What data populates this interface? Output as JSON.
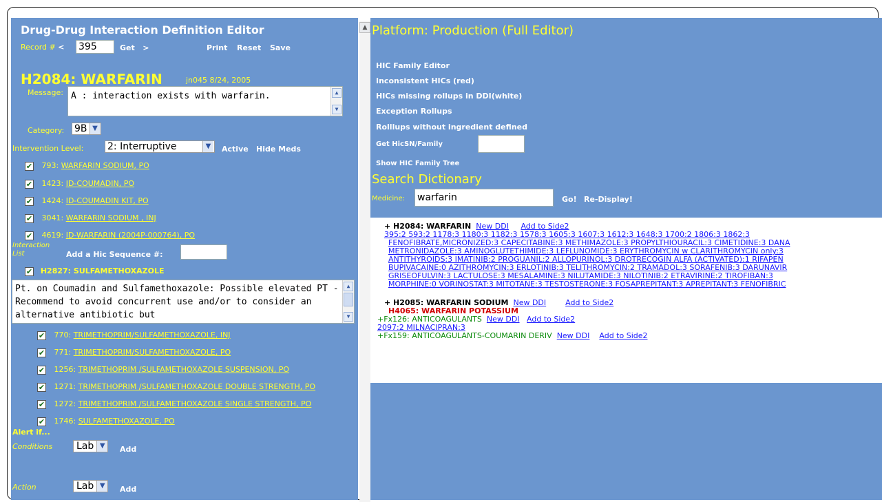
{
  "editor": {
    "title": "Drug-Drug Interaction Definition Editor",
    "record_label": "Record #",
    "record_lt": "<",
    "record_value": "395",
    "get_label": "Get",
    "get_gt": ">",
    "print": "Print",
    "reset": "Reset",
    "save": "Save",
    "hic_heading": "H2084: WARFARIN",
    "hic_meta": "jn045 8/24, 2005",
    "message_label": "Message:",
    "message_value": "A : interaction exists with warfarin.",
    "category_label": "Category:",
    "category_value": "9B",
    "intervention_label": "Intervention Level:",
    "intervention_value": "2: Interruptive",
    "active": "Active",
    "hide_meds": "Hide Meds",
    "meds1": [
      {
        "id": "793:",
        "name": "WARFARIN SODIUM, PO"
      },
      {
        "id": "1423:",
        "name": "ID-COUMADIN, PO"
      },
      {
        "id": "1424:",
        "name": "ID-COUMADIN KIT, PO"
      },
      {
        "id": "3041:",
        "name": "WARFARIN SODIUM , INJ"
      },
      {
        "id": "4619:",
        "name": "ID-WARFARIN (2004P-000764), PO"
      }
    ],
    "interaction_list_label": "Interaction List",
    "add_hic_label": "Add a Hic Sequence #:",
    "hic2_heading": "H2827: SULFAMETHOXAZOLE",
    "hic2_message": "Pt. on Coumadin and Sulfamethoxazole: Possible elevated PT - Recommend to avoid concurrent use and/or to consider an alternative antibiotic but",
    "meds2": [
      {
        "id": "770:",
        "name": "TRIMETHOPRIM/SULFAMETHOXAZOLE, INJ"
      },
      {
        "id": "771:",
        "name": "TRIMETHOPRIM/SULFAMETHOXAZOLE, PO"
      },
      {
        "id": "1256:",
        "name": "TRIMETHOPRIM /SULFAMETHOXAZOLE SUSPENSION, PO"
      },
      {
        "id": "1271:",
        "name": "TRIMETHOPRIM /SULFAMETHOXAZOLE DOUBLE STRENGTH, PO"
      },
      {
        "id": "1272:",
        "name": "TRIMETHOPRIM /SULFAMETHOXAZOLE SINGLE STRENGTH, PO"
      },
      {
        "id": "1746:",
        "name": "SULFAMETHOXAZOLE, PO"
      }
    ],
    "alert_if": "Alert if...",
    "conditions_label": "Conditions",
    "conditions_value": "Lab",
    "add": "Add",
    "action_label": "Action",
    "action_value": "Lab"
  },
  "platform": {
    "title": "Platform: Production (Full Editor)",
    "links": [
      "HIC Family Editor",
      "Inconsistent HICs (red)",
      "HICs missing rollups in DDI(white)",
      "Exception Rollups",
      "Rolllups without ingredient defined"
    ],
    "get_hicsn_label": "Get HicSN/Family",
    "show_tree": "Show HIC Family Tree",
    "search_title": "Search Dictionary",
    "medicine_label": "Medicine:",
    "medicine_value": "warfarin",
    "go": "Go!",
    "redisplay": "Re-Display!"
  },
  "results": {
    "r1_prefix": "+ H2084: WARFARIN",
    "new_ddi": "New DDI",
    "add_side2": "Add to Side2",
    "r1_lines": [
      "395:2  593:2  1178:3  1180:3  1182:3  1578:3  1605:3  1607:3  1612:3  1648:3  1700:2  1806:3  1862:3",
      "FENOFIBRATE,MICRONIZED:3  CAPECITABINE:3  METHIMAZOLE:3  PROPYLTHIOURACIL:3  CIMETIDINE:3  DANA",
      "METRONIDAZOLE:3  AMINOGLUTETHIMIDE:3  LEFLUNOMIDE:3  ERYTHROMYCIN w CLARITHROMYCIN only:3",
      "ANTITHYROIDS:3  IMATINIB:2  PROGUANIL:2  ALLOPURINOL:3  DROTRECOGIN ALFA (ACTIVATED):1  RIFAPEN",
      "BUPIVACAINE:0  AZITHROMYCIN:3  ERLOTINIB:3  TELITHROMYCIN:2  TRAMADOL:3  SORAFENIB:3  DARUNAVIR",
      "GRISEOFULVIN:3  LACTULOSE:3  MESALAMINE:3  NILUTAMIDE:3  NILOTINIB:2  ETRAVIRINE:2  TIROFIBAN:3",
      "MORPHINE:0  VORINOSTAT:3  MITOTANE:3  TESTOSTERONE:3  FOSAPREPITANT:3  APREPITANT:3  FENOFIBRIC"
    ],
    "r2_prefix": "+ H2085: WARFARIN SODIUM",
    "r2_red": "H4065: WARFARIN POTASSIUM",
    "r3_prefix": "+Fx126: ANTICOAGULANTS",
    "r3_line": "2097:2  MILNACIPRAN:3",
    "r4_prefix": "+Fx159: ANTICOAGULANTS-COUMARIN DERIV"
  }
}
